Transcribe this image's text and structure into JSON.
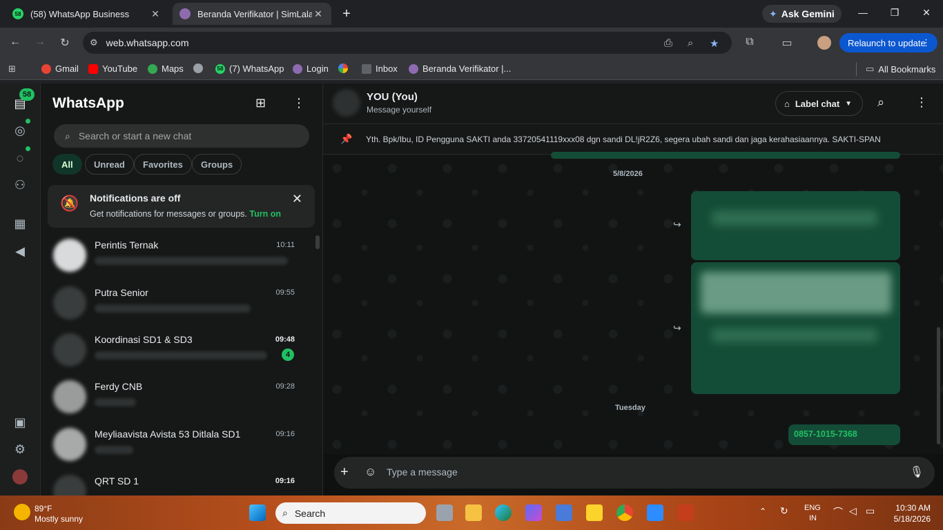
{
  "browser": {
    "tabs": [
      {
        "badge": "58",
        "title": "(58) WhatsApp Business",
        "favicon_color": "#25d366"
      },
      {
        "title": "Beranda Verifikator | SimLala",
        "favicon_color": "#8e6bb0"
      }
    ],
    "gemini_label": "Ask Gemini",
    "url": "web.whatsapp.com",
    "relaunch_label": "Relaunch to update",
    "bookmarks": [
      {
        "label": "Gmail",
        "color": "#ea4335"
      },
      {
        "label": "YouTube",
        "color": "#ff0000"
      },
      {
        "label": "Maps",
        "color": "#34a853"
      },
      {
        "label": "",
        "color": "#9aa0a6"
      },
      {
        "label": "(7) WhatsApp",
        "badge": "58",
        "color": "#25d366"
      },
      {
        "label": "Login",
        "color": "#8e6bb0"
      },
      {
        "label": "",
        "color": "#fbbc04"
      },
      {
        "label": "Inbox",
        "color": "#5f6368"
      },
      {
        "label": "Beranda Verifikator |...",
        "color": "#8e6bb0"
      }
    ],
    "all_bookmarks_label": "All Bookmarks"
  },
  "wa": {
    "rail": {
      "chats_badge": "58"
    },
    "title": "WhatsApp",
    "search_placeholder": "Search or start a new chat",
    "filters": [
      "All",
      "Unread",
      "Favorites",
      "Groups"
    ],
    "notification": {
      "title": "Notifications are off",
      "body": "Get notifications for messages or groups.",
      "action": "Turn on"
    },
    "chats": [
      {
        "name": "Perintis Ternak",
        "time": "10:11",
        "unread": ""
      },
      {
        "name": "Putra Senior",
        "time": "09:55",
        "unread": ""
      },
      {
        "name": "Koordinasi SD1 & SD3",
        "time": "09:48",
        "unread": "4"
      },
      {
        "name": "Ferdy CNB",
        "time": "09:28",
        "unread": ""
      },
      {
        "name": "Meyliaavista Avista 53 Ditlala SD1",
        "time": "09:16",
        "unread": ""
      },
      {
        "name": "QRT SD 1",
        "time": "09:16",
        "unread": ""
      }
    ],
    "conversation": {
      "name": "YOU (You)",
      "subtitle": "Message yourself",
      "label_chat": "Label chat",
      "pinned": "Yth. Bpk/Ibu, ID Pengguna SAKTI anda 33720541119xxx08 dgn sandi DL!jR2Z6, segera ubah sandi dan jaga kerahasiaannya. SAKTI-SPAN",
      "date1": "5/8/2026",
      "date2": "Tuesday",
      "last_message": "0857-1015-7368",
      "composer_placeholder": "Type a message"
    },
    "accent": "#21c063"
  },
  "taskbar": {
    "weather_temp": "89°F",
    "weather_desc": "Mostly sunny",
    "search_label": "Search",
    "lang1": "ENG",
    "lang2": "IN",
    "time": "10:30 AM",
    "date": "5/18/2026"
  }
}
